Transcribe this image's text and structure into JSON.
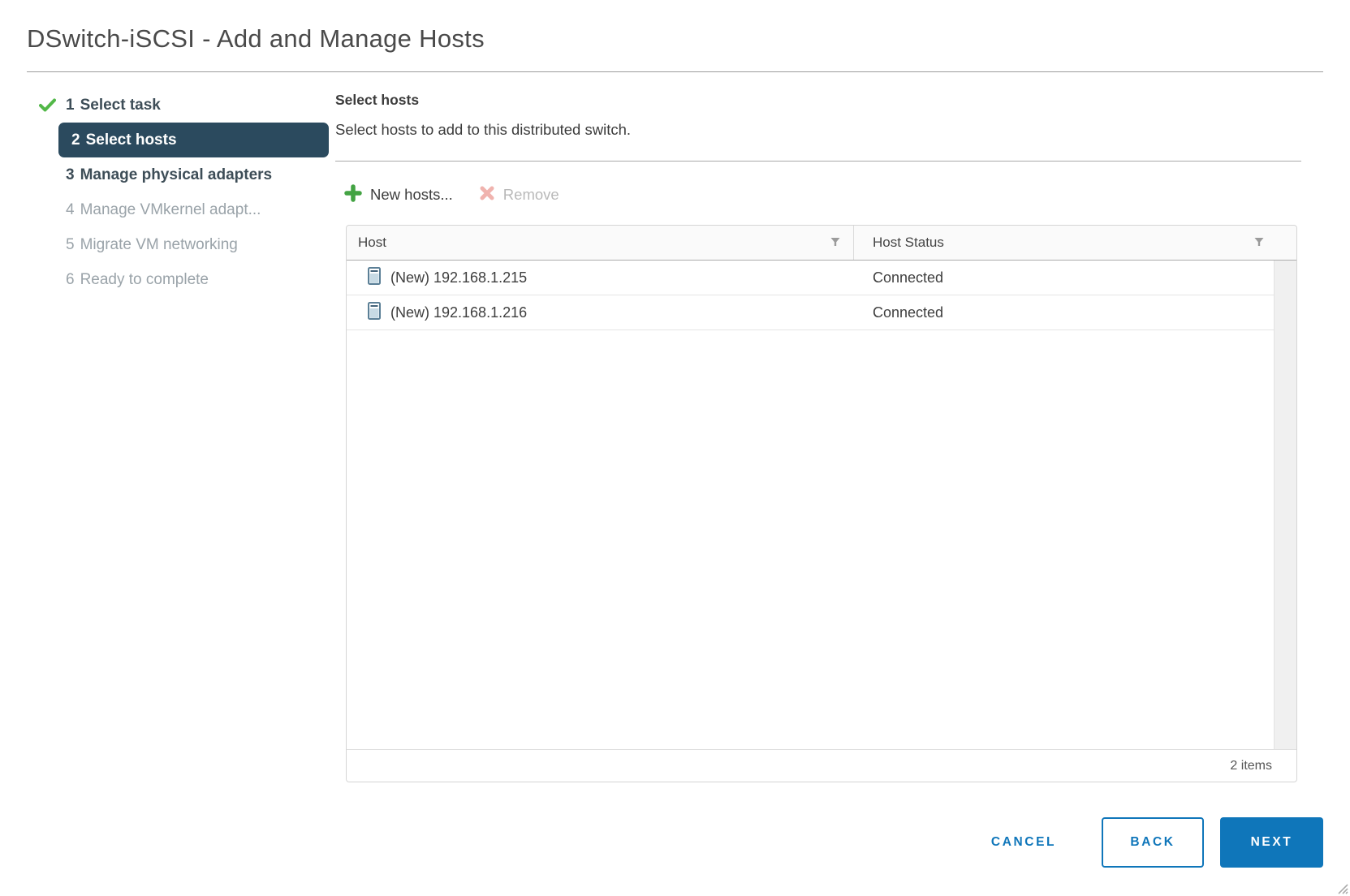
{
  "title": "DSwitch-iSCSI - Add and Manage Hosts",
  "colors": {
    "accent_blue": "#0f76ba",
    "active_step_bg": "#2b4a5e",
    "check_green": "#52b848",
    "plus_green": "#43a343",
    "remove_red_disabled": "#f0b3ae"
  },
  "steps": [
    {
      "number": "1",
      "label": "Select task",
      "state": "completed"
    },
    {
      "number": "2",
      "label": "Select hosts",
      "state": "active"
    },
    {
      "number": "3",
      "label": "Manage physical adapters",
      "state": "available"
    },
    {
      "number": "4",
      "label": "Manage VMkernel adapt...",
      "state": "disabled"
    },
    {
      "number": "5",
      "label": "Migrate VM networking",
      "state": "disabled"
    },
    {
      "number": "6",
      "label": "Ready to complete",
      "state": "disabled"
    }
  ],
  "content": {
    "heading": "Select hosts",
    "description": "Select hosts to add to this distributed switch.",
    "toolbar": {
      "new_hosts_label": "New hosts...",
      "remove_label": "Remove"
    },
    "table": {
      "columns": [
        "Host",
        "Host Status"
      ],
      "rows": [
        {
          "host": "(New) 192.168.1.215",
          "status": "Connected"
        },
        {
          "host": "(New) 192.168.1.216",
          "status": "Connected"
        }
      ],
      "items_count": "2 items"
    }
  },
  "footer_buttons": {
    "cancel": "CANCEL",
    "back": "BACK",
    "next": "NEXT"
  },
  "icons": {
    "completed_step": "green-check-icon",
    "new_hosts": "green-plus-icon",
    "remove": "red-x-icon",
    "column_filter": "funnel-icon",
    "host_row": "esxi-host-icon",
    "window_corner": "resize-grip-icon"
  }
}
